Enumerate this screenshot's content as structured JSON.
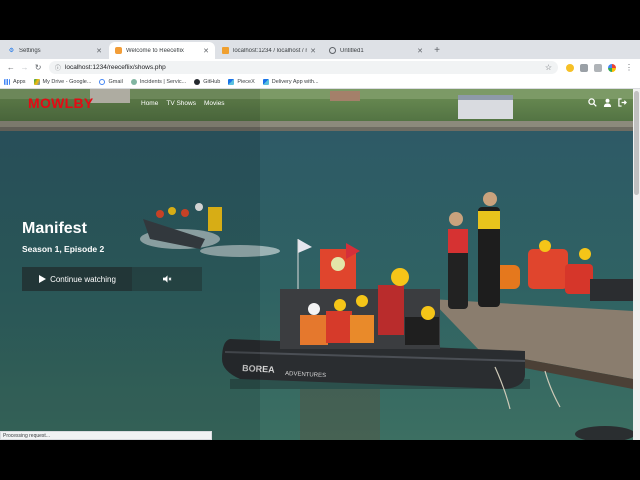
{
  "browser": {
    "tabs": [
      {
        "title": "Settings",
        "active": false
      },
      {
        "title": "Welcome to Reeceflix",
        "active": true
      },
      {
        "title": "localhost:1234 / localhost / ree",
        "active": false
      },
      {
        "title": "Untitled1",
        "active": false
      }
    ],
    "new_tab": "+",
    "url": "localhost:1234/reeceflix/shows.php",
    "bookmarks": [
      {
        "label": "Apps",
        "icon": "apps-grid-icon"
      },
      {
        "label": "My Drive - Google...",
        "icon": "drive-icon"
      },
      {
        "label": "Gmail",
        "icon": "google-icon"
      },
      {
        "label": "Incidents | Servic...",
        "icon": "servicenow-icon"
      },
      {
        "label": "GitHub",
        "icon": "github-icon"
      },
      {
        "label": "PieceX",
        "icon": "piecex-icon"
      },
      {
        "label": "Delivery App with...",
        "icon": "piecex-icon"
      }
    ]
  },
  "site": {
    "logo": "MOWLBY",
    "nav": [
      {
        "label": "Home"
      },
      {
        "label": "TV Shows"
      },
      {
        "label": "Movies"
      }
    ],
    "hero": {
      "title": "Manifest",
      "subtitle": "Season 1, Episode 2",
      "continue_label": "Continue watching"
    },
    "accent_color": "#e50914"
  },
  "status_bar": "Processing request..."
}
